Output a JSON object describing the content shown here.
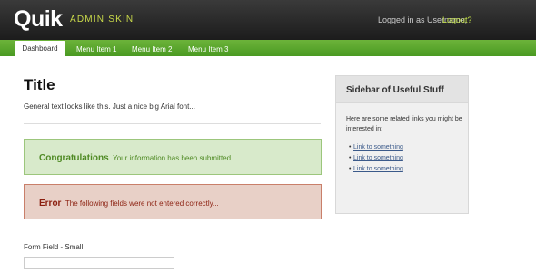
{
  "header": {
    "logo": "Quik",
    "logo_subtitle": "ADMIN SKIN",
    "login_text": "Logged in as Username,",
    "logout_label": "Logout?"
  },
  "nav": {
    "active": "Dashboard",
    "items": [
      "Menu Item 1",
      "Menu Item 2",
      "Menu Item 3"
    ]
  },
  "main": {
    "title": "Title",
    "intro": "General text looks like this. Just a nice big Arial font...",
    "success": {
      "strong": "Congratulations",
      "text": "Your information has been submitted..."
    },
    "error": {
      "strong": "Error",
      "text": "The following fields were not entered correctly..."
    },
    "form": {
      "label": "Form Field - Small",
      "value": ""
    }
  },
  "sidebar": {
    "title": "Sidebar of Useful Stuff",
    "text": "Here are some related links you might be interested in:",
    "links": [
      "Link to something",
      "Link to something",
      "Link to something"
    ]
  },
  "colors": {
    "accent_green": "#5aa82c",
    "success_bg": "#d8eacb",
    "error_bg": "#e8d0c7",
    "logo_accent": "#c9d94a"
  }
}
